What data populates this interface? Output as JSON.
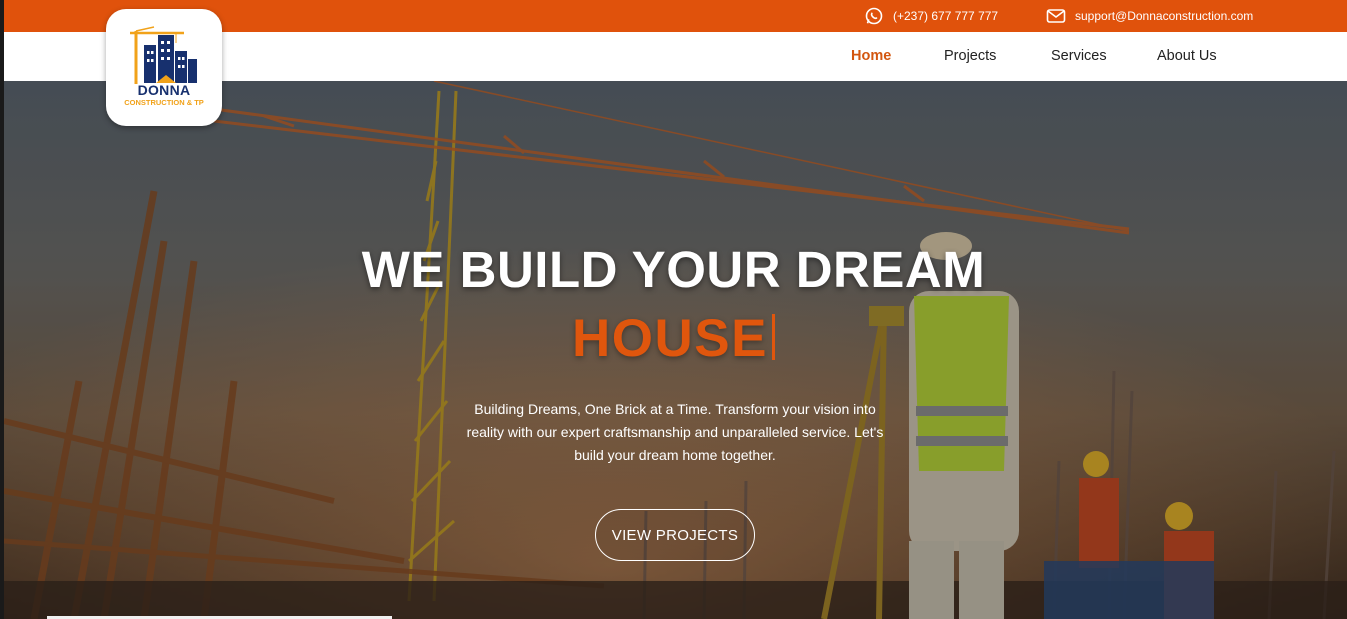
{
  "topbar": {
    "phone": "(+237) 677 777 777",
    "email": "support@Donnaconstruction.com",
    "phone_icon": "whatsapp-icon",
    "email_icon": "envelope-icon",
    "color": "#e0520c"
  },
  "logo": {
    "name": "DONNA",
    "tagline": "CONSTRUCTION & TP"
  },
  "nav": {
    "items": [
      {
        "label": "Home",
        "active": true
      },
      {
        "label": "Projects",
        "active": false
      },
      {
        "label": "Services",
        "active": false
      },
      {
        "label": "About Us",
        "active": false
      }
    ],
    "active_color": "#d3560f"
  },
  "hero": {
    "headline": "WE BUILD YOUR DREAM",
    "highlight": "HOUSE",
    "highlight_color": "#e0560d",
    "subtitle": "Building Dreams, One Brick at a Time. Transform your vision into reality with our expert craftsmanship and unparalleled service. Let's build your dream home together.",
    "cta_label": "VIEW PROJECTS"
  }
}
